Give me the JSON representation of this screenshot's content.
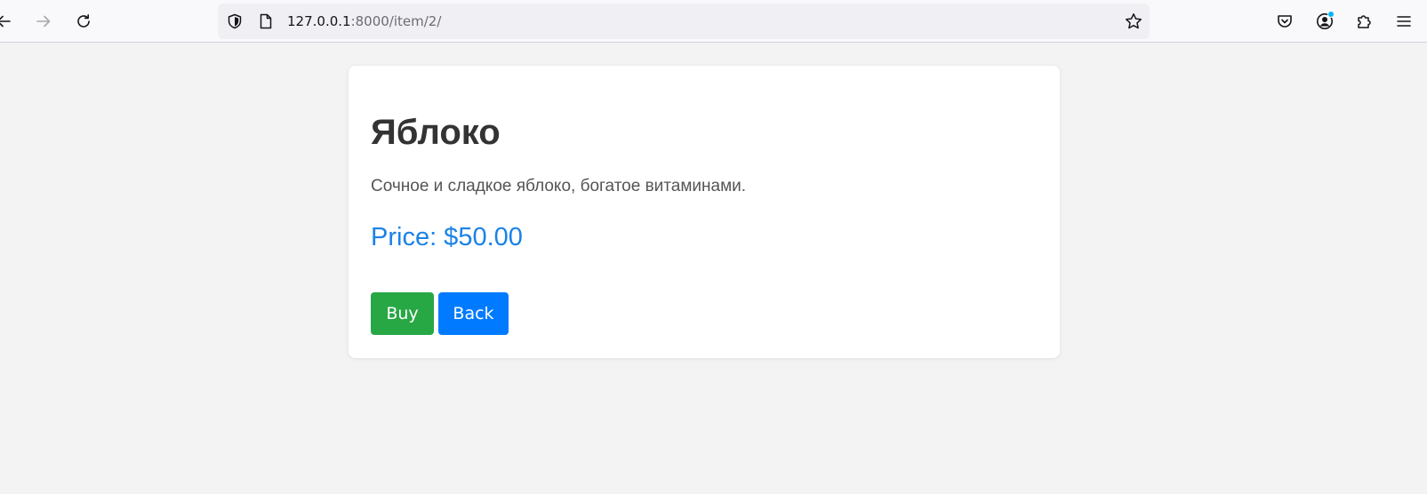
{
  "browser": {
    "url_host": "127.0.0.1",
    "url_rest": ":8000/item/2/",
    "icons": {
      "back": "arrow-left-icon",
      "forward": "arrow-right-icon",
      "reload": "reload-icon",
      "tracking_protection": "shield-icon",
      "page_info": "page-icon",
      "bookmark": "star-icon",
      "pocket": "pocket-icon",
      "account": "account-icon",
      "extensions": "puzzle-icon",
      "menu": "hamburger-menu-icon"
    },
    "colors": {
      "toolbar_bg": "#f9f9fb",
      "urlbar_bg": "#f0f0f4",
      "notification_dot": "#00b3f4"
    }
  },
  "item": {
    "name": "Яблоко",
    "description": "Сочное и сладкое яблоко, богатое витаминами.",
    "price_text": "Price: $50.00"
  },
  "actions": {
    "buy_label": "Buy",
    "back_label": "Back"
  },
  "colors": {
    "page_bg": "#f3f3f3",
    "price": "#1a82e6",
    "buy_button": "#28a745",
    "back_button": "#007bff"
  }
}
